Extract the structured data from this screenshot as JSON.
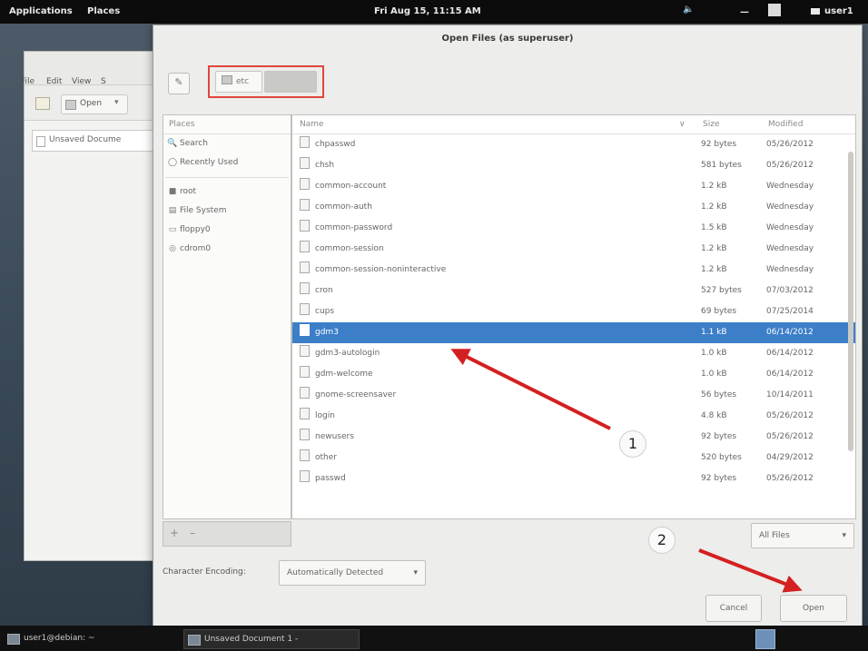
{
  "topbar": {
    "applications": "Applications",
    "places": "Places",
    "clock": "Fri Aug 15, 11:15 AM",
    "user": "user1",
    "icons": [
      "volume-icon",
      "chat-icon",
      "user-icon"
    ]
  },
  "background_window": {
    "menu": [
      "File",
      "Edit",
      "View",
      "S"
    ],
    "open_button": "Open",
    "doc_tab": "Unsaved Docume"
  },
  "dialog": {
    "title": "Open Files (as superuser)",
    "path": [
      {
        "label": "etc",
        "icon": "folder-icon"
      },
      {
        "label": "",
        "selected": true
      }
    ],
    "places_header": "Places",
    "places": [
      {
        "label": "Search",
        "icon": "search-icon"
      },
      {
        "label": "Recently Used",
        "icon": "recent-icon"
      },
      {
        "label": "root",
        "icon": "folder-icon"
      },
      {
        "label": "File System",
        "icon": "drive-icon"
      },
      {
        "label": "floppy0",
        "icon": "floppy-icon"
      },
      {
        "label": "cdrom0",
        "icon": "cdrom-icon"
      }
    ],
    "columns": {
      "name": "Name",
      "size": "Size",
      "modified": "Modified"
    },
    "files": [
      {
        "name": "chpasswd",
        "size": "92 bytes",
        "modified": "05/26/2012"
      },
      {
        "name": "chsh",
        "size": "581 bytes",
        "modified": "05/26/2012"
      },
      {
        "name": "common-account",
        "size": "1.2 kB",
        "modified": "Wednesday"
      },
      {
        "name": "common-auth",
        "size": "1.2 kB",
        "modified": "Wednesday"
      },
      {
        "name": "common-password",
        "size": "1.5 kB",
        "modified": "Wednesday"
      },
      {
        "name": "common-session",
        "size": "1.2 kB",
        "modified": "Wednesday"
      },
      {
        "name": "common-session-noninteractive",
        "size": "1.2 kB",
        "modified": "Wednesday"
      },
      {
        "name": "cron",
        "size": "527 bytes",
        "modified": "07/03/2012"
      },
      {
        "name": "cups",
        "size": "69 bytes",
        "modified": "07/25/2014"
      },
      {
        "name": "gdm3",
        "size": "1.1 kB",
        "modified": "06/14/2012",
        "selected": true
      },
      {
        "name": "gdm3-autologin",
        "size": "1.0 kB",
        "modified": "06/14/2012"
      },
      {
        "name": "gdm-welcome",
        "size": "1.0 kB",
        "modified": "06/14/2012"
      },
      {
        "name": "gnome-screensaver",
        "size": "56 bytes",
        "modified": "10/14/2011"
      },
      {
        "name": "login",
        "size": "4.8 kB",
        "modified": "05/26/2012"
      },
      {
        "name": "newusers",
        "size": "92 bytes",
        "modified": "05/26/2012"
      },
      {
        "name": "other",
        "size": "520 bytes",
        "modified": "04/29/2012"
      },
      {
        "name": "passwd",
        "size": "92 bytes",
        "modified": "05/26/2012"
      }
    ],
    "filter": "All Files",
    "encoding_label": "Character Encoding:",
    "encoding_value": "Automatically Detected",
    "cancel": "Cancel",
    "open": "Open"
  },
  "annotations": {
    "step1": "1",
    "step2": "2",
    "arrow_color": "#d42020",
    "highlight_color": "#e0453c"
  },
  "taskbar": {
    "terminal": "user1@debian: ~",
    "document": "Unsaved Document 1 -"
  }
}
